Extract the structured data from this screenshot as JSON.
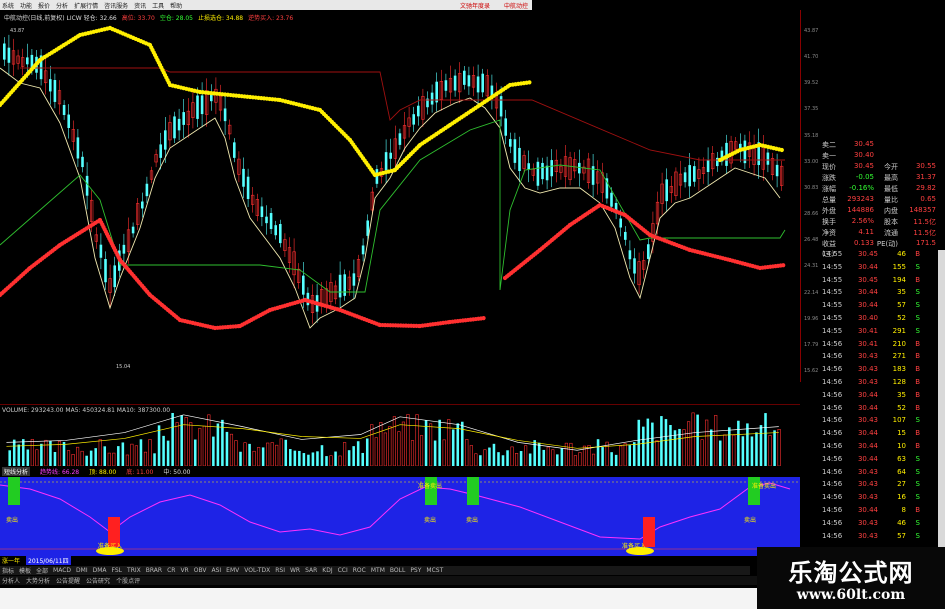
{
  "menubar": {
    "items": [
      "系统",
      "功能",
      "报价",
      "分析",
      "扩展行情",
      "咨讯服务",
      "资讯",
      "工具",
      "帮助"
    ],
    "app_name": "文驰年度录",
    "broker": "中航动控"
  },
  "chart_info": {
    "title": "中航动控(日线,前复权) LICW 轻仓: 32.66",
    "items": [
      "高位: 33.70",
      "空仓: 28.05",
      "止损选仓: 34.88",
      "逆势买入: 23.76"
    ]
  },
  "price_labels": {
    "high": "43.87",
    "low": "15.04",
    "axis": [
      "43.87",
      "41.70",
      "39.52",
      "37.35",
      "35.18",
      "33.00",
      "30.83",
      "28.66",
      "26.48",
      "24.31",
      "22.14",
      "19.96",
      "17.79",
      "15.62"
    ]
  },
  "volume": {
    "label": "VOLUME: 293243.00  MA5: 450324.81  MA10: 387300.00"
  },
  "indicator_bar": {
    "name": "短线分析",
    "v1": "趋势线: 66.28",
    "v2": "顶: 88.00",
    "v3": "底: 11.00",
    "v4": "中: 50.00"
  },
  "indicator_markers": {
    "sell": "卖出",
    "sell_alt": "准备卖出",
    "buy_ready": "准备买入"
  },
  "date_row": {
    "label": "涨一年",
    "date": "2015/06/11四"
  },
  "tabs_row1": [
    "指标",
    "模板",
    "全部",
    "MACD",
    "DMI",
    "DMA",
    "FSL",
    "TRIX",
    "BRAR",
    "CR",
    "VR",
    "OBV",
    "ASI",
    "EMV",
    "VOL-TDX",
    "RSI",
    "WR",
    "SAR",
    "KDJ",
    "CCI",
    "ROC",
    "MTM",
    "BOLL",
    "PSY",
    "MCST"
  ],
  "tabs_row2": [
    "分析人",
    "大势分析",
    "公告提醒",
    "公告研究",
    "个股点评"
  ],
  "quote": {
    "rows": [
      {
        "l1": "卖二",
        "v1": "30.45",
        "l2": "",
        "v2": ""
      },
      {
        "l1": "卖一",
        "v1": "30.40",
        "l2": "",
        "v2": ""
      },
      {
        "l1": "现价",
        "v1": "30.45",
        "l2": "今开",
        "v2": "30.55"
      },
      {
        "l1": "涨跌",
        "v1": "-0.05",
        "l2": "最高",
        "v2": "31.37"
      },
      {
        "l1": "涨幅",
        "v1": "-0.16%",
        "l2": "最低",
        "v2": "29.82"
      },
      {
        "l1": "总量",
        "v1": "293243",
        "l2": "量比",
        "v2": "0.65"
      },
      {
        "l1": "外盘",
        "v1": "144886",
        "l2": "内盘",
        "v2": "148357"
      },
      {
        "l1": "换手",
        "v1": "2.56%",
        "l2": "股本",
        "v2": "11.5亿"
      },
      {
        "l1": "净资",
        "v1": "4.11",
        "l2": "流通",
        "v2": "11.5亿"
      },
      {
        "l1": "收益(三)",
        "v1": "0.133",
        "l2": "PE(动)",
        "v2": "171.5"
      }
    ]
  },
  "ticks": {
    "rows": [
      {
        "t": "14:55",
        "p": "30.45",
        "v": "46",
        "s": "B"
      },
      {
        "t": "14:55",
        "p": "30.44",
        "v": "155",
        "s": "S"
      },
      {
        "t": "14:55",
        "p": "30.45",
        "v": "194",
        "s": "B"
      },
      {
        "t": "14:55",
        "p": "30.44",
        "v": "35",
        "s": "S"
      },
      {
        "t": "14:55",
        "p": "30.44",
        "v": "57",
        "s": "S"
      },
      {
        "t": "14:55",
        "p": "30.40",
        "v": "52",
        "s": "S"
      },
      {
        "t": "14:55",
        "p": "30.41",
        "v": "291",
        "s": "S"
      },
      {
        "t": "14:56",
        "p": "30.41",
        "v": "210",
        "s": "B"
      },
      {
        "t": "14:56",
        "p": "30.43",
        "v": "271",
        "s": "B"
      },
      {
        "t": "14:56",
        "p": "30.43",
        "v": "183",
        "s": "B"
      },
      {
        "t": "14:56",
        "p": "30.43",
        "v": "128",
        "s": "B"
      },
      {
        "t": "14:56",
        "p": "30.44",
        "v": "35",
        "s": "B"
      },
      {
        "t": "14:56",
        "p": "30.44",
        "v": "52",
        "s": "B"
      },
      {
        "t": "14:56",
        "p": "30.43",
        "v": "107",
        "s": "S"
      },
      {
        "t": "14:56",
        "p": "30.44",
        "v": "15",
        "s": "B"
      },
      {
        "t": "14:56",
        "p": "30.44",
        "v": "10",
        "s": "B"
      },
      {
        "t": "14:56",
        "p": "30.44",
        "v": "63",
        "s": "S"
      },
      {
        "t": "14:56",
        "p": "30.43",
        "v": "64",
        "s": "S"
      },
      {
        "t": "14:56",
        "p": "30.43",
        "v": "27",
        "s": "S"
      },
      {
        "t": "14:56",
        "p": "30.43",
        "v": "16",
        "s": "S"
      },
      {
        "t": "14:56",
        "p": "30.44",
        "v": "8",
        "s": "B"
      },
      {
        "t": "14:56",
        "p": "30.43",
        "v": "46",
        "s": "S"
      },
      {
        "t": "14:56",
        "p": "30.43",
        "v": "57",
        "s": "S"
      }
    ]
  },
  "watermark": {
    "cn": "乐淘公式网",
    "url": "www.60lt.com"
  },
  "colors": {
    "up": "#ff3030",
    "down": "#55ffff",
    "yellow": "#ffef00",
    "indicator_bg": "#1e23e6"
  },
  "icons": [
    "menu-app-icon"
  ]
}
